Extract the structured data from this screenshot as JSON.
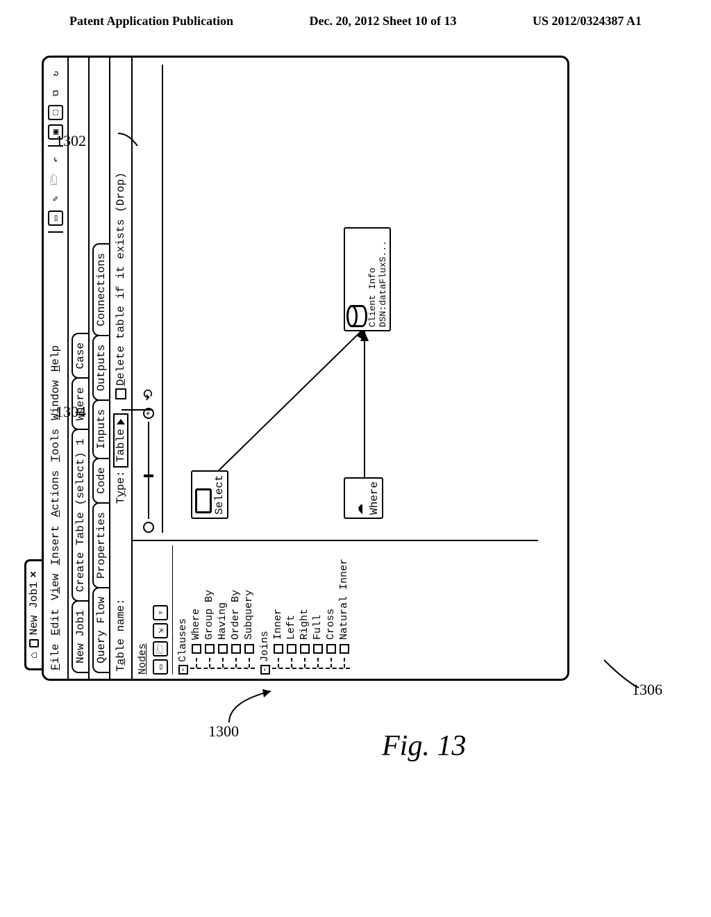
{
  "header": {
    "left": "Patent Application Publication",
    "center": "Dec. 20, 2012  Sheet 10 of 13",
    "right": "US 2012/0324387 A1"
  },
  "figure": {
    "caption": "Fig. 13",
    "callouts": {
      "c1300": "1300",
      "c1302": "1302",
      "c1304": "1304",
      "c1306": "1306"
    }
  },
  "window": {
    "tab_title": "New Job1",
    "tab_close": "×"
  },
  "menu": {
    "file": "File",
    "edit": "Edit",
    "view": "View",
    "insert": "Insert",
    "actions": "Actions",
    "tools": "Tools",
    "window": "Window",
    "help": "Help"
  },
  "tabs_primary": {
    "t1": "New Job1",
    "t2": "Create Table (select) 1",
    "t3": "Where",
    "t4": "Case"
  },
  "tabs_secondary": {
    "s1": "Query Flow",
    "s2": "Properties",
    "s3": "Code",
    "s4": "Inputs",
    "s5": "Outputs",
    "s6": "Connections"
  },
  "properties": {
    "table_name_label": "Table name:",
    "type_label": "Type:",
    "type_value": "Table",
    "delete_label": "Delete table if it exists (Drop)"
  },
  "sidebar": {
    "title": "Nodes",
    "clauses": {
      "label": "Clauses",
      "items": [
        "Where",
        "Group By",
        "Having",
        "Order By",
        "Subquery"
      ]
    },
    "joins": {
      "label": "Joins",
      "items": [
        "Inner",
        "Left",
        "Right",
        "Full",
        "Cross",
        "Natural Inner"
      ]
    }
  },
  "canvas_nodes": {
    "select": "Select",
    "where": "Where",
    "client": "Client Info\nDSN:dataFluxS..."
  }
}
